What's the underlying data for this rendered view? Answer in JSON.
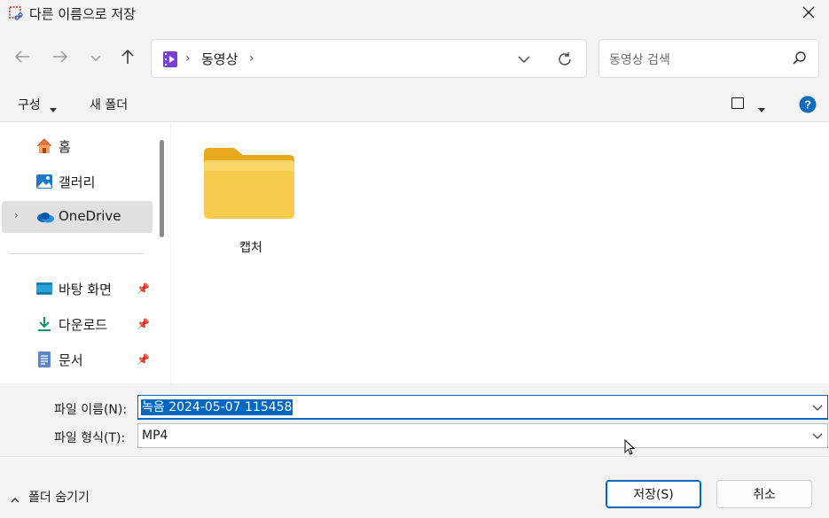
{
  "window": {
    "title": "다른 이름으로 저장",
    "title_icon": "snipping-tool-icon",
    "close_icon": "close-icon"
  },
  "nav": {
    "back_icon": "arrow-left-icon",
    "forward_icon": "arrow-right-icon",
    "recent_icon": "chevron-down-icon",
    "up_icon": "arrow-up-icon",
    "address": {
      "folder_icon": "videos-folder-icon",
      "path_label": "동영상",
      "dropdown_icon": "chevron-down-icon",
      "refresh_icon": "refresh-icon"
    },
    "search": {
      "placeholder": "동영상 검색",
      "icon": "search-icon"
    }
  },
  "commandbar": {
    "organize_label": "구성",
    "new_folder_label": "새 폴더",
    "view_icon": "view-layout-icon",
    "help_icon": "help-icon"
  },
  "sidebar": {
    "items": [
      {
        "label": "홈",
        "icon": "home-icon",
        "pinned": false,
        "selected": false
      },
      {
        "label": "갤러리",
        "icon": "gallery-icon",
        "pinned": false,
        "selected": false
      },
      {
        "label": "OneDrive",
        "icon": "onedrive-icon",
        "pinned": false,
        "selected": true
      },
      {
        "label": "바탕 화면",
        "icon": "desktop-icon",
        "pinned": true,
        "selected": false
      },
      {
        "label": "다운로드",
        "icon": "download-icon",
        "pinned": true,
        "selected": false
      },
      {
        "label": "문서",
        "icon": "documents-icon",
        "pinned": true,
        "selected": false
      }
    ]
  },
  "content": {
    "folders": [
      {
        "name": "캡처",
        "icon": "folder-icon"
      }
    ]
  },
  "form": {
    "filename_label": "파일 이름(N):",
    "filename_value": "녹음 2024-05-07 115458",
    "filetype_label": "파일 형식(T):",
    "filetype_value": "MP4"
  },
  "footer": {
    "hide_folders_label": "폴더 숨기기",
    "save_label": "저장(S)",
    "cancel_label": "취소"
  },
  "colors": {
    "accent": "#0067c0",
    "folder": "#f5c342",
    "help": "#0f6cbd"
  }
}
